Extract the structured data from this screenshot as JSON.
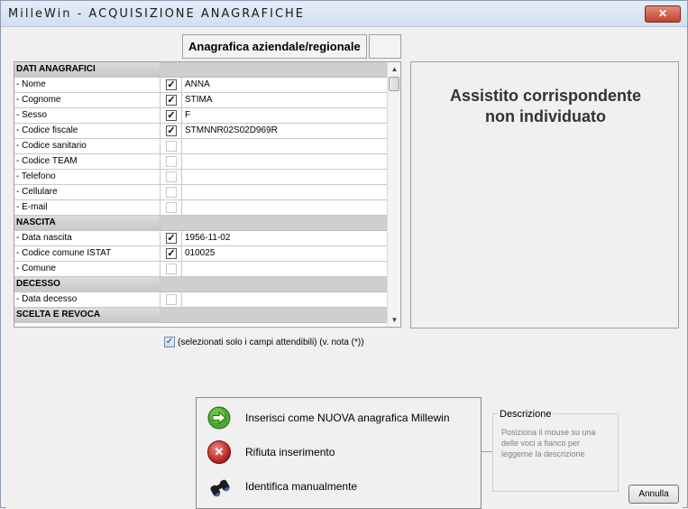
{
  "window": {
    "title": "MilleWin - ACQUISIZIONE ANAGRAFICHE",
    "close_label": "✕"
  },
  "header": {
    "column_title": "Anagrafica aziendale/regionale"
  },
  "grid": {
    "rows": [
      {
        "type": "section",
        "label": "DATI ANAGRAFICI"
      },
      {
        "type": "field",
        "label": "- Nome",
        "checked": true,
        "value": "ANNA"
      },
      {
        "type": "field",
        "label": "- Cognome",
        "checked": true,
        "value": "STIMA"
      },
      {
        "type": "field",
        "label": "- Sesso",
        "checked": true,
        "value": "F"
      },
      {
        "type": "field",
        "label": "- Codice fiscale",
        "checked": true,
        "value": "STMNNR02S02D969R"
      },
      {
        "type": "field",
        "label": "- Codice sanitario",
        "checked": false,
        "value": ""
      },
      {
        "type": "field",
        "label": "- Codice TEAM",
        "checked": false,
        "value": ""
      },
      {
        "type": "field",
        "label": "- Telefono",
        "checked": false,
        "value": ""
      },
      {
        "type": "field",
        "label": "- Cellulare",
        "checked": false,
        "value": ""
      },
      {
        "type": "field",
        "label": "- E-mail",
        "checked": false,
        "value": ""
      },
      {
        "type": "section",
        "label": "NASCITA"
      },
      {
        "type": "field",
        "label": "- Data nascita",
        "checked": true,
        "value": "1956-11-02"
      },
      {
        "type": "field",
        "label": "- Codice comune ISTAT",
        "checked": true,
        "value": "010025"
      },
      {
        "type": "field",
        "label": "- Comune",
        "checked": false,
        "value": ""
      },
      {
        "type": "section",
        "label": "DECESSO"
      },
      {
        "type": "field",
        "label": "- Data decesso",
        "checked": false,
        "value": ""
      },
      {
        "type": "section",
        "label": "SCELTA E REVOCA"
      }
    ]
  },
  "status": {
    "line1": "Assistito corrispondente",
    "line2": "non individuato"
  },
  "note": {
    "checked": true,
    "text": "(selezionati solo i campi attendibili) (v. nota (*))"
  },
  "actions": {
    "insert_label": "Inserisci come NUOVA anagrafica Millewin",
    "reject_label": "Rifiuta inserimento",
    "identify_label": "Identifica manualmente"
  },
  "description": {
    "title": "Descrizione",
    "text": "Posiziona il mouse su una delle voci a fianco per leggerne la descrizione"
  },
  "buttons": {
    "cancel_label": "Annulla"
  },
  "colors": {
    "accent": "#3c9a20",
    "danger": "#b51a1a"
  },
  "icons": {
    "insert": "arrow-right-green-icon",
    "reject": "x-red-icon",
    "identify": "binoculars-icon"
  }
}
